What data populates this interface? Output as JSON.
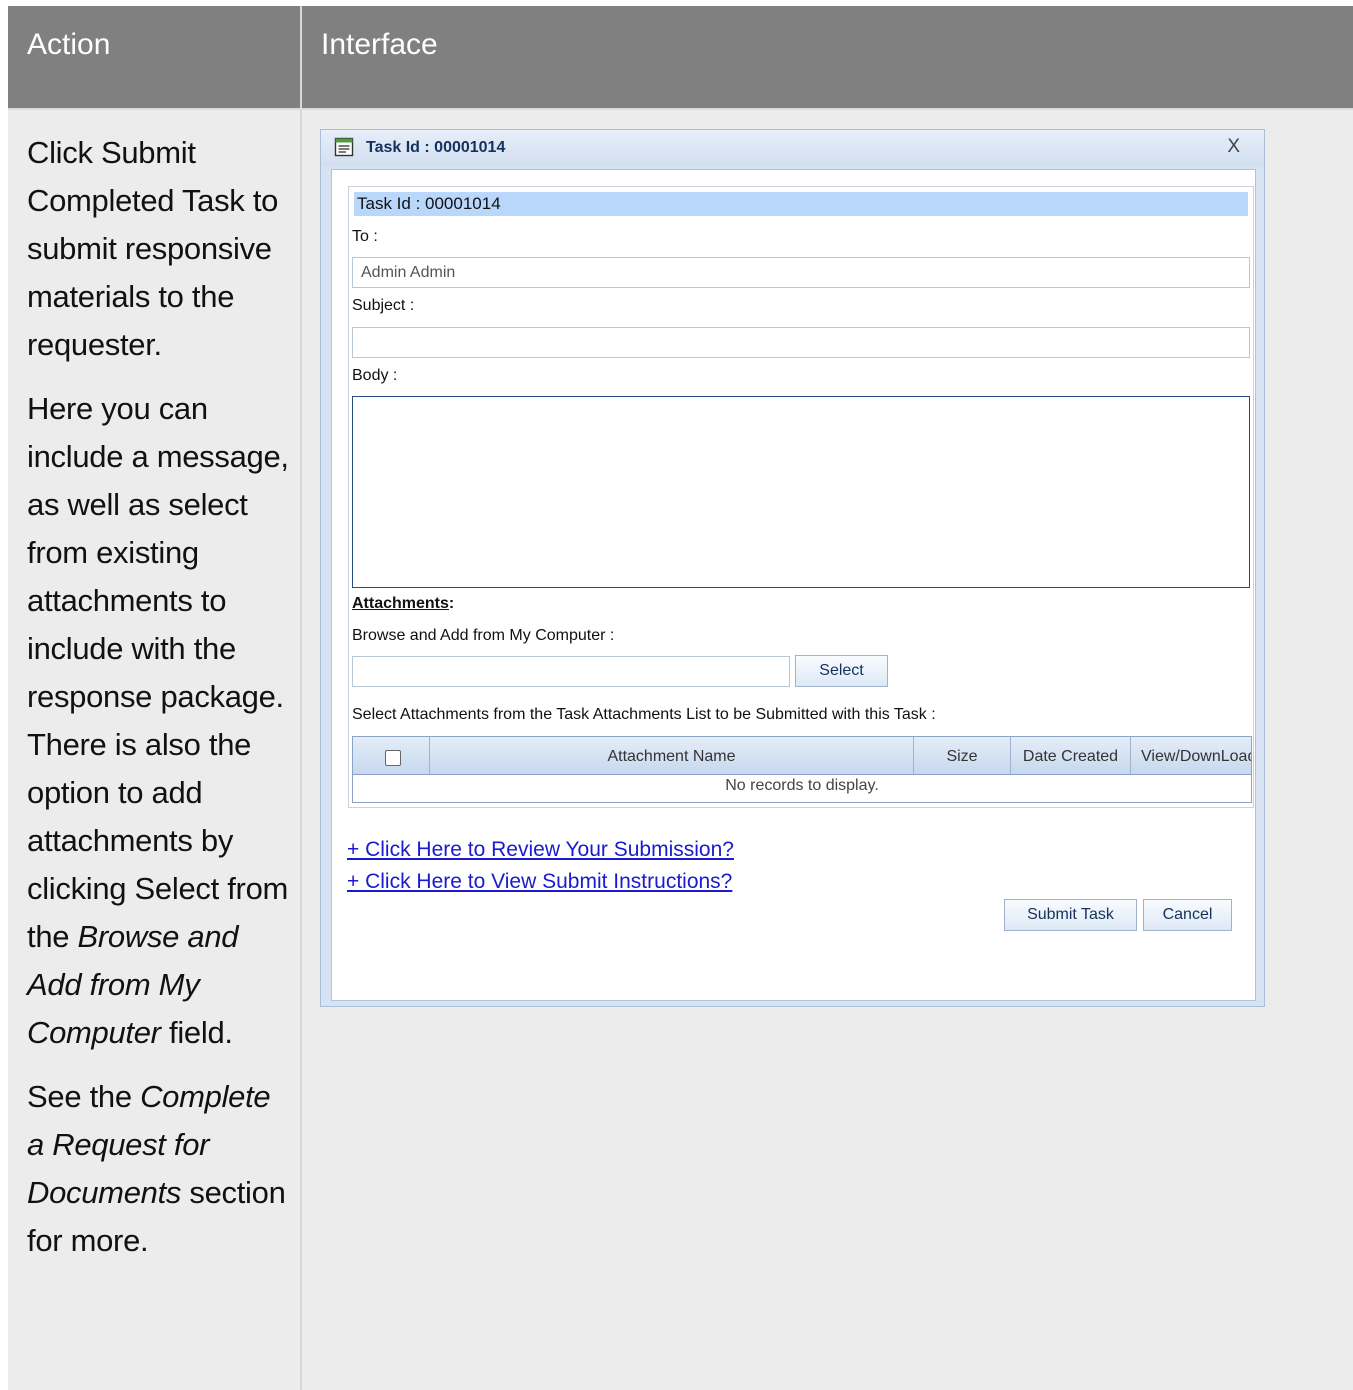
{
  "table": {
    "header_action": "Action",
    "header_interface": "Interface"
  },
  "action": {
    "p1": "Click Submit Completed Task to submit responsive materials to the requester.",
    "p2_a": "Here you can include a message, as well as select from existing attachments to include with the response package. There is also the option to add attachments by clicking Select from the ",
    "p2_em": "Browse and Add from My Computer",
    "p2_b": " field.",
    "p3_a": "See the ",
    "p3_em": "Complete a Request for Documents",
    "p3_b": " section for more."
  },
  "dialog": {
    "title": "Task Id : 00001014",
    "close_label": "X",
    "task_bar": "Task Id : 00001014",
    "to_label": "To :",
    "to_value": "Admin Admin",
    "subject_label": "Subject :",
    "subject_value": "",
    "body_label": "Body :",
    "attachments_label": "Attachments",
    "attachments_colon": ":",
    "browse_label": "Browse and Add from My Computer :",
    "select_button": "Select",
    "select_list_label": "Select Attachments from the Task Attachments List to be Submitted with this Task :",
    "grid_columns": [
      "Attachment Name",
      "Size",
      "Date Created",
      "View/DownLoad"
    ],
    "grid_empty": "No records to display.",
    "review_link": "+ Click Here to Review Your Submission?",
    "instructions_link": "+ Click Here to View Submit Instructions?",
    "submit_button": "Submit Task",
    "cancel_button": "Cancel"
  }
}
